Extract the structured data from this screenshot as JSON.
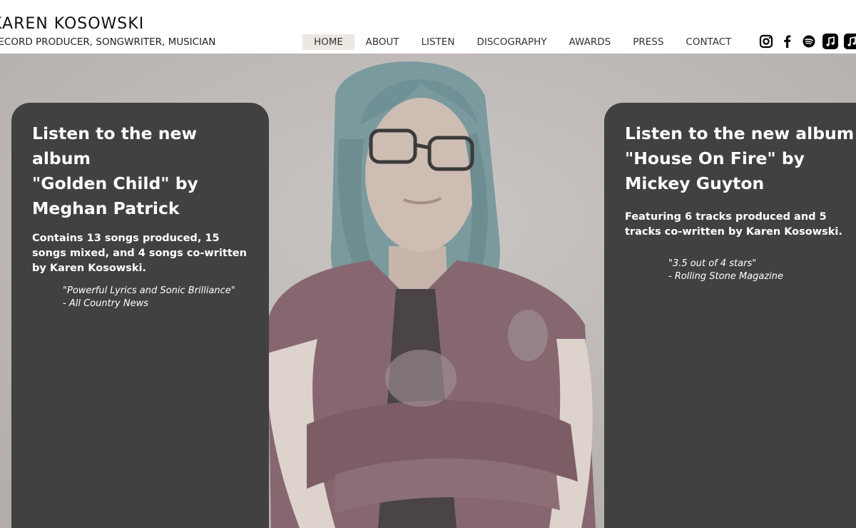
{
  "header": {
    "name": "KAREN KOSOWSKI",
    "tagline": "RECORD PRODUCER, SONGWRITER, MUSICIAN"
  },
  "nav": {
    "items": [
      "HOME",
      "ABOUT",
      "LISTEN",
      "DISCOGRAPHY",
      "AWARDS",
      "PRESS",
      "CONTACT"
    ],
    "active": "HOME"
  },
  "socials": [
    "instagram-icon",
    "facebook-icon",
    "spotify-icon",
    "apple-music-icon",
    "apple-music-icon"
  ],
  "colors": {
    "card_bg": "#414141",
    "nav_active_bg": "#ece8e2",
    "hero_bg": "#bcb7b5"
  },
  "cards": [
    {
      "title_lines": [
        "Listen to the new album",
        "\"Golden Child\" by",
        "Meghan Patrick"
      ],
      "description": "Contains 13 songs produced, 15 songs mixed, and 4 songs co-written by Karen Kosowski.",
      "quote": "\"Powerful Lyrics and Sonic Brilliance\"",
      "source": "- All Country News"
    },
    {
      "title_lines": [
        "Listen to the new album",
        "\"House On Fire\" by",
        "Mickey Guyton"
      ],
      "description": "Featuring 6 tracks produced and 5 tracks co-written by Karen Kosowski.",
      "quote": "\"3.5 out of 4 stars\"",
      "source": "- Rolling Stone Magazine"
    }
  ]
}
